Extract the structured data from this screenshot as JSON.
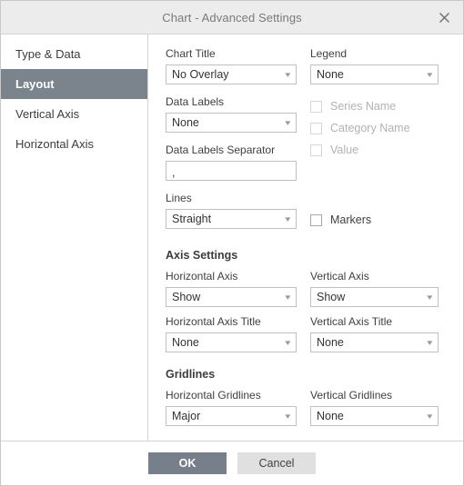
{
  "window": {
    "title": "Chart - Advanced Settings",
    "close_icon": "close-icon"
  },
  "sidebar": {
    "items": [
      {
        "label": "Type & Data",
        "active": false
      },
      {
        "label": "Layout",
        "active": true
      },
      {
        "label": "Vertical Axis",
        "active": false
      },
      {
        "label": "Horizontal Axis",
        "active": false
      }
    ]
  },
  "layout_panel": {
    "chart_title": {
      "label": "Chart Title",
      "value": "No Overlay"
    },
    "legend": {
      "label": "Legend",
      "value": "None"
    },
    "data_labels": {
      "label": "Data Labels",
      "value": "None"
    },
    "data_labels_separator": {
      "label": "Data Labels Separator",
      "value": ","
    },
    "checkboxes": [
      {
        "label": "Series Name",
        "checked": false,
        "disabled": true
      },
      {
        "label": "Category Name",
        "checked": false,
        "disabled": true
      },
      {
        "label": "Value",
        "checked": false,
        "disabled": true
      }
    ],
    "lines": {
      "label": "Lines",
      "value": "Straight"
    },
    "markers": {
      "label": "Markers",
      "checked": false,
      "disabled": false
    },
    "axis_settings": {
      "heading": "Axis Settings",
      "horizontal_axis": {
        "label": "Horizontal Axis",
        "value": "Show"
      },
      "vertical_axis": {
        "label": "Vertical Axis",
        "value": "Show"
      },
      "horizontal_axis_title": {
        "label": "Horizontal Axis Title",
        "value": "None"
      },
      "vertical_axis_title": {
        "label": "Vertical Axis Title",
        "value": "None"
      }
    },
    "gridlines": {
      "heading": "Gridlines",
      "horizontal_gridlines": {
        "label": "Horizontal Gridlines",
        "value": "Major"
      },
      "vertical_gridlines": {
        "label": "Vertical Gridlines",
        "value": "None"
      }
    }
  },
  "footer": {
    "ok_label": "OK",
    "cancel_label": "Cancel"
  },
  "colors": {
    "accent": "#77808a",
    "titlebar_bg": "#ececec",
    "border": "#c0c0c0"
  }
}
